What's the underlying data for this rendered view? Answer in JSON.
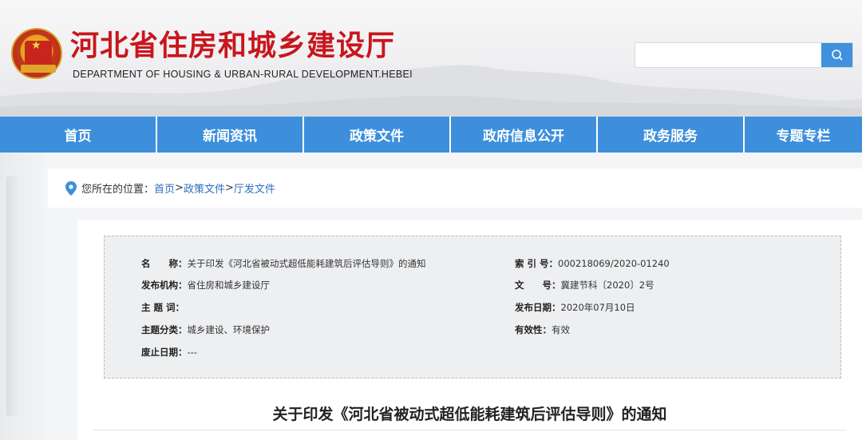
{
  "header": {
    "title": "河北省住房和城乡建设厅",
    "subtitle": "DEPARTMENT OF HOUSING & URBAN-RURAL DEVELOPMENT.HEBEI",
    "search": {
      "value": "",
      "placeholder": ""
    }
  },
  "nav": {
    "items": [
      {
        "label": "首页"
      },
      {
        "label": "新闻资讯"
      },
      {
        "label": "政策文件"
      },
      {
        "label": "政府信息公开"
      },
      {
        "label": "政务服务"
      },
      {
        "label": "专题专栏"
      }
    ]
  },
  "breadcrumb": {
    "prefix": "您所在的位置：",
    "items": [
      {
        "label": "首页"
      },
      {
        "label": "政策文件"
      },
      {
        "label": "厅发文件"
      }
    ],
    "separator": ">"
  },
  "meta": {
    "name_label": "名　　称：",
    "name_value": "关于印发《河北省被动式超低能耗建筑后评估导则》的通知",
    "index_label": "索 引 号：",
    "index_value": "000218069/2020-01240",
    "org_label": "发布机构：",
    "org_value": "省住房和城乡建设厅",
    "docno_label": "文　　号：",
    "docno_value": "冀建节科〔2020〕2号",
    "subject_label": "主 题 词：",
    "subject_value": "",
    "date_label": "发布日期：",
    "date_value": "2020年07月10日",
    "category_label": "主题分类：",
    "category_value": "城乡建设、环境保护",
    "validity_label": "有效性：",
    "validity_value": "有效",
    "expire_label": "废止日期：",
    "expire_value": "---"
  },
  "document": {
    "title": "关于印发《河北省被动式超低能耗建筑后评估导则》的通知"
  },
  "colors": {
    "brand_red": "#c8161d",
    "nav_blue": "#3d8fdc",
    "link_blue": "#2d6fbf"
  }
}
